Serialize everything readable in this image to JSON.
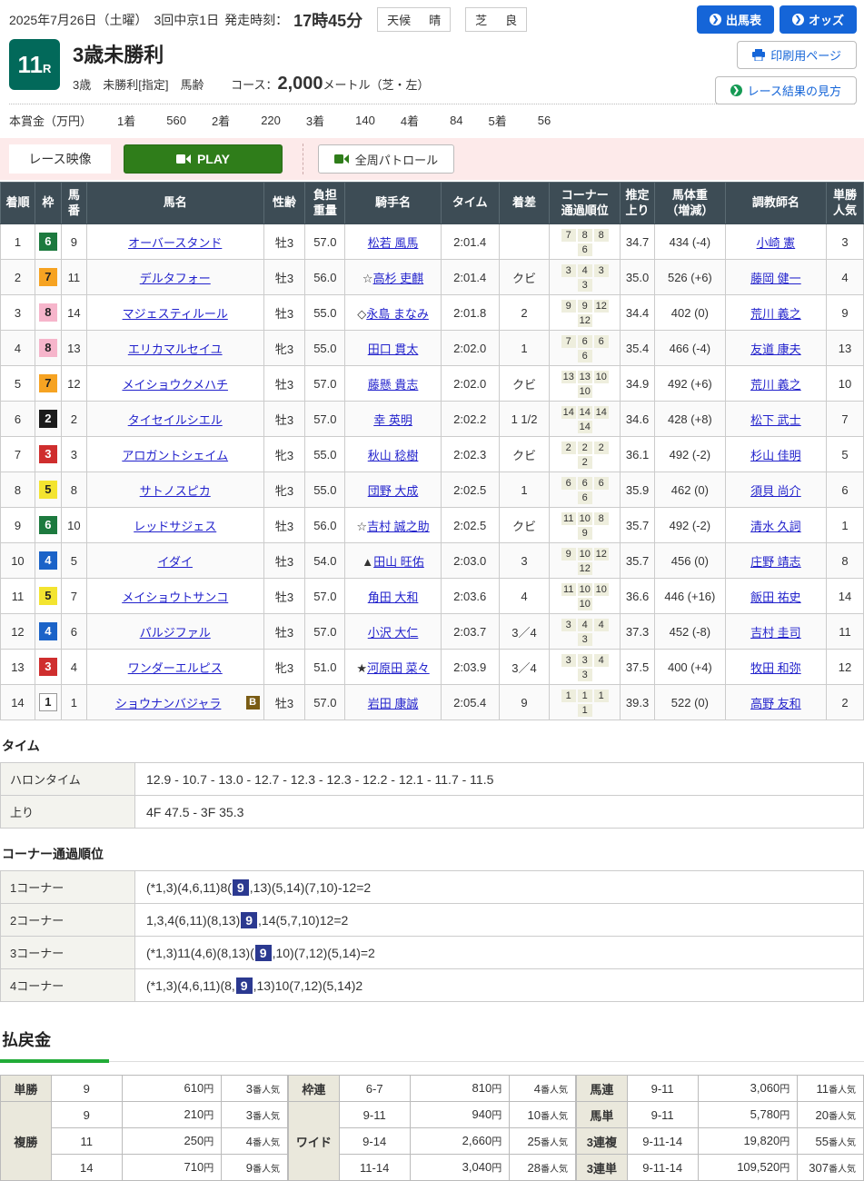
{
  "header": {
    "date_line": "2025年7月26日（土曜）　3回中京1日",
    "start_label": "発走時刻：",
    "start_time": "17時45分",
    "weather_label": "天候",
    "weather_value": "晴",
    "turf_label": "芝",
    "turf_value": "良",
    "race_number": "11",
    "race_number_suffix": "R",
    "race_title": "3歳未勝利",
    "race_conditions": "3歳　未勝利[指定]　馬齢",
    "course_label": "コース：",
    "course_distance": "2,000",
    "course_suffix": "メートル（芝・左）",
    "buttons": {
      "entries": "出馬表",
      "odds": "オッズ",
      "print": "印刷用ページ",
      "guide": "レース結果の見方"
    },
    "prize": {
      "label": "本賞金（万円）",
      "items": [
        {
          "place": "1着",
          "amount": "560"
        },
        {
          "place": "2着",
          "amount": "220"
        },
        {
          "place": "3着",
          "amount": "140"
        },
        {
          "place": "4着",
          "amount": "84"
        },
        {
          "place": "5着",
          "amount": "56"
        }
      ]
    }
  },
  "video_bar": {
    "label": "レース映像",
    "play": "PLAY",
    "patrol": "全周パトロール"
  },
  "results": {
    "columns": [
      "着順",
      "枠",
      "馬\n番",
      "馬名",
      "性齢",
      "負担\n重量",
      "騎手名",
      "タイム",
      "着差",
      "コーナー\n通過順位",
      "推定\n上り",
      "馬体重\n（増減）",
      "調教師名",
      "単勝\n人気"
    ],
    "rows": [
      {
        "pos": "1",
        "frame": "6",
        "num": "9",
        "name": "オーバースタンド",
        "b": false,
        "sexage": "牡3",
        "weight": "57.0",
        "jprefix": "",
        "jockey": "松若 風馬",
        "time": "2:01.4",
        "margin": "",
        "corners": [
          "7",
          "8",
          "8",
          "6"
        ],
        "last3f": "34.7",
        "hweight": "434 (-4)",
        "trainer": "小崎 憲",
        "fav": "3"
      },
      {
        "pos": "2",
        "frame": "7",
        "num": "11",
        "name": "デルタフォー",
        "b": false,
        "sexage": "牡3",
        "weight": "56.0",
        "jprefix": "☆",
        "jockey": "高杉 吏麒",
        "time": "2:01.4",
        "margin": "クビ",
        "corners": [
          "3",
          "4",
          "3",
          "3"
        ],
        "last3f": "35.0",
        "hweight": "526 (+6)",
        "trainer": "藤岡 健一",
        "fav": "4"
      },
      {
        "pos": "3",
        "frame": "8",
        "num": "14",
        "name": "マジェスティルール",
        "b": false,
        "sexage": "牡3",
        "weight": "55.0",
        "jprefix": "◇",
        "jockey": "永島 まなみ",
        "time": "2:01.8",
        "margin": "2",
        "corners": [
          "9",
          "9",
          "12",
          "12"
        ],
        "last3f": "34.4",
        "hweight": "402 (0)",
        "trainer": "荒川 義之",
        "fav": "9"
      },
      {
        "pos": "4",
        "frame": "8",
        "num": "13",
        "name": "エリカマルセイユ",
        "b": false,
        "sexage": "牝3",
        "weight": "55.0",
        "jprefix": "",
        "jockey": "田口 貫太",
        "time": "2:02.0",
        "margin": "1",
        "corners": [
          "7",
          "6",
          "6",
          "6"
        ],
        "last3f": "35.4",
        "hweight": "466 (-4)",
        "trainer": "友道 康夫",
        "fav": "13"
      },
      {
        "pos": "5",
        "frame": "7",
        "num": "12",
        "name": "メイショウクメハチ",
        "b": false,
        "sexage": "牡3",
        "weight": "57.0",
        "jprefix": "",
        "jockey": "藤懸 貴志",
        "time": "2:02.0",
        "margin": "クビ",
        "corners": [
          "13",
          "13",
          "10",
          "10"
        ],
        "last3f": "34.9",
        "hweight": "492 (+6)",
        "trainer": "荒川 義之",
        "fav": "10"
      },
      {
        "pos": "6",
        "frame": "2",
        "num": "2",
        "name": "タイセイルシエル",
        "b": false,
        "sexage": "牡3",
        "weight": "57.0",
        "jprefix": "",
        "jockey": "幸 英明",
        "time": "2:02.2",
        "margin": "1 1/2",
        "corners": [
          "14",
          "14",
          "14",
          "14"
        ],
        "last3f": "34.6",
        "hweight": "428 (+8)",
        "trainer": "松下 武士",
        "fav": "7"
      },
      {
        "pos": "7",
        "frame": "3",
        "num": "3",
        "name": "アロガントシェイム",
        "b": false,
        "sexage": "牝3",
        "weight": "55.0",
        "jprefix": "",
        "jockey": "秋山 稔樹",
        "time": "2:02.3",
        "margin": "クビ",
        "corners": [
          "2",
          "2",
          "2",
          "2"
        ],
        "last3f": "36.1",
        "hweight": "492 (-2)",
        "trainer": "杉山 佳明",
        "fav": "5"
      },
      {
        "pos": "8",
        "frame": "5",
        "num": "8",
        "name": "サトノスピカ",
        "b": false,
        "sexage": "牝3",
        "weight": "55.0",
        "jprefix": "",
        "jockey": "団野 大成",
        "time": "2:02.5",
        "margin": "1",
        "corners": [
          "6",
          "6",
          "6",
          "6"
        ],
        "last3f": "35.9",
        "hweight": "462 (0)",
        "trainer": "須貝 尚介",
        "fav": "6"
      },
      {
        "pos": "9",
        "frame": "6",
        "num": "10",
        "name": "レッドサジェス",
        "b": false,
        "sexage": "牡3",
        "weight": "56.0",
        "jprefix": "☆",
        "jockey": "吉村 誠之助",
        "time": "2:02.5",
        "margin": "クビ",
        "corners": [
          "11",
          "10",
          "8",
          "9"
        ],
        "last3f": "35.7",
        "hweight": "492 (-2)",
        "trainer": "清水 久詞",
        "fav": "1"
      },
      {
        "pos": "10",
        "frame": "4",
        "num": "5",
        "name": "イダイ",
        "b": false,
        "sexage": "牡3",
        "weight": "54.0",
        "jprefix": "▲",
        "jockey": "田山 旺佑",
        "time": "2:03.0",
        "margin": "3",
        "corners": [
          "9",
          "10",
          "12",
          "12"
        ],
        "last3f": "35.7",
        "hweight": "456 (0)",
        "trainer": "庄野 靖志",
        "fav": "8"
      },
      {
        "pos": "11",
        "frame": "5",
        "num": "7",
        "name": "メイショウトサンコ",
        "b": false,
        "sexage": "牡3",
        "weight": "57.0",
        "jprefix": "",
        "jockey": "角田 大和",
        "time": "2:03.6",
        "margin": "4",
        "corners": [
          "11",
          "10",
          "10",
          "10"
        ],
        "last3f": "36.6",
        "hweight": "446 (+16)",
        "trainer": "飯田 祐史",
        "fav": "14"
      },
      {
        "pos": "12",
        "frame": "4",
        "num": "6",
        "name": "パルジファル",
        "b": false,
        "sexage": "牡3",
        "weight": "57.0",
        "jprefix": "",
        "jockey": "小沢 大仁",
        "time": "2:03.7",
        "margin": "3／4",
        "corners": [
          "3",
          "4",
          "4",
          "3"
        ],
        "last3f": "37.3",
        "hweight": "452 (-8)",
        "trainer": "吉村 圭司",
        "fav": "11"
      },
      {
        "pos": "13",
        "frame": "3",
        "num": "4",
        "name": "ワンダーエルピス",
        "b": false,
        "sexage": "牝3",
        "weight": "51.0",
        "jprefix": "★",
        "jockey": "河原田 菜々",
        "time": "2:03.9",
        "margin": "3／4",
        "corners": [
          "3",
          "3",
          "4",
          "3"
        ],
        "last3f": "37.5",
        "hweight": "400 (+4)",
        "trainer": "牧田 和弥",
        "fav": "12"
      },
      {
        "pos": "14",
        "frame": "1",
        "num": "1",
        "name": "ショウナンバジャラ",
        "b": true,
        "sexage": "牡3",
        "weight": "57.0",
        "jprefix": "",
        "jockey": "岩田 康誠",
        "time": "2:05.4",
        "margin": "9",
        "corners": [
          "1",
          "1",
          "1",
          "1"
        ],
        "last3f": "39.3",
        "hweight": "522 (0)",
        "trainer": "高野 友和",
        "fav": "2"
      }
    ]
  },
  "time_section": {
    "title": "タイム",
    "halon_label": "ハロンタイム",
    "halon": "12.9 - 10.7 - 13.0 - 12.7 - 12.3 - 12.3 - 12.2 - 12.1 - 11.7 - 11.5",
    "agari_label": "上り",
    "agari": "4F 47.5 - 3F 35.3"
  },
  "corner_section": {
    "title": "コーナー通過順位",
    "rows": [
      {
        "label": "1コーナー",
        "before": "(*1,3)(4,6,11)8(",
        "hl": "9",
        "after": ",13)(5,14)(7,10)-12=2"
      },
      {
        "label": "2コーナー",
        "before": "1,3,4(6,11)(8,13)",
        "hl": "9",
        "after": ",14(5,7,10)12=2"
      },
      {
        "label": "3コーナー",
        "before": "(*1,3)11(4,6)(8,13)(",
        "hl": "9",
        "after": ",10)(7,12)(5,14)=2"
      },
      {
        "label": "4コーナー",
        "before": "(*1,3)(4,6,11)(8,",
        "hl": "9",
        "after": ",13)10(7,12)(5,14)2"
      }
    ]
  },
  "payout": {
    "title": "払戻金",
    "yen": "円",
    "pop_suffix": "番人気",
    "tansho_label": "単勝",
    "fukusho_label": "複勝",
    "wakuren_label": "枠連",
    "wide_label": "ワイド",
    "umaren_label": "馬連",
    "umatan_label": "馬単",
    "sanrenpuku_label": "3連複",
    "sanrentan_label": "3連単",
    "tansho": [
      {
        "c": "9",
        "a": "610",
        "p": "3"
      }
    ],
    "fukusho": [
      {
        "c": "9",
        "a": "210",
        "p": "3"
      },
      {
        "c": "11",
        "a": "250",
        "p": "4"
      },
      {
        "c": "14",
        "a": "710",
        "p": "9"
      }
    ],
    "wakuren": [
      {
        "c": "6-7",
        "a": "810",
        "p": "4"
      }
    ],
    "wide": [
      {
        "c": "9-11",
        "a": "940",
        "p": "10"
      },
      {
        "c": "9-14",
        "a": "2,660",
        "p": "25"
      },
      {
        "c": "11-14",
        "a": "3,040",
        "p": "28"
      }
    ],
    "umaren": {
      "c": "9-11",
      "a": "3,060",
      "p": "11"
    },
    "umatan": {
      "c": "9-11",
      "a": "5,780",
      "p": "20"
    },
    "sanrenpuku": {
      "c": "9-11-14",
      "a": "19,820",
      "p": "55"
    },
    "sanrentan": {
      "c": "9-11-14",
      "a": "109,520",
      "p": "307"
    }
  }
}
